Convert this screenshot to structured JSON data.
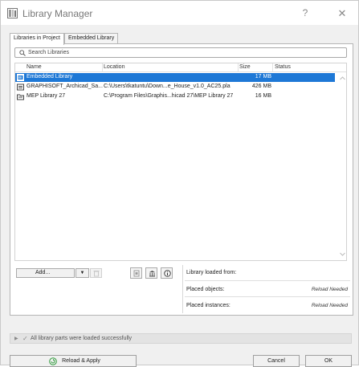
{
  "window": {
    "title": "Library Manager"
  },
  "titlebar": {
    "help": "?",
    "close": "✕"
  },
  "tabs": [
    {
      "label": "Libraries in Project",
      "active": true
    },
    {
      "label": "Embedded Library",
      "active": false
    }
  ],
  "search": {
    "placeholder": "Search Libraries"
  },
  "table": {
    "columns": [
      "Name",
      "Location",
      "Size",
      "Status"
    ],
    "rows": [
      {
        "name": "Embedded Library",
        "location": "",
        "size": "17 MB",
        "status": "",
        "selected": true,
        "icon": "embedded-library-icon"
      },
      {
        "name": "GRAPHISOFT_Archicad_Sa...",
        "location": "C:\\Users\\tkatuntu\\Down...e_House_v1.0_AC25.pla",
        "size": "426 MB",
        "status": "",
        "selected": false,
        "icon": "archive-library-icon"
      },
      {
        "name": "MEP Library 27",
        "location": "C:\\Program Files\\Graphis...hicad 27\\MEP Library 27",
        "size": "16 MB",
        "status": "",
        "selected": false,
        "icon": "folder-library-icon"
      }
    ]
  },
  "actions": {
    "add_label": "Add...",
    "add_dropdown": "▼"
  },
  "info": {
    "loaded_from_label": "Library loaded from:",
    "placed_objects_label": "Placed objects:",
    "placed_objects_value": "Reload Needed",
    "placed_instances_label": "Placed instances:",
    "placed_instances_value": "Reload Needed"
  },
  "status": {
    "message": "All library parts were loaded successfully"
  },
  "footer": {
    "reload_apply_label": "Reload & Apply",
    "cancel_label": "Cancel",
    "ok_label": "OK"
  },
  "colors": {
    "selection": "#1e78d6",
    "reload_icon": "#2e9a3a"
  }
}
